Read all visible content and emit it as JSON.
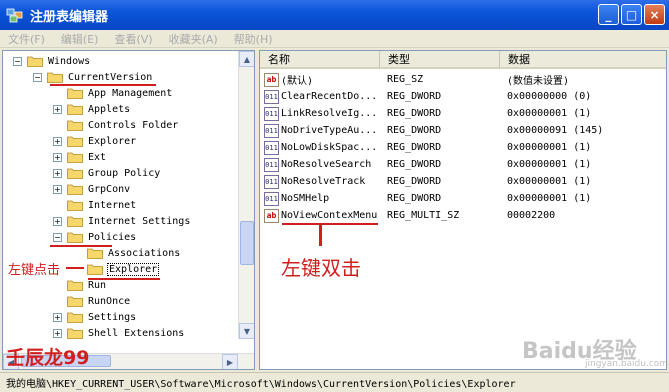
{
  "window": {
    "title": "注册表编辑器",
    "min": "_",
    "max": "□",
    "close": "×"
  },
  "menu": [
    "文件(F)",
    "编辑(E)",
    "查看(V)",
    "收藏夹(A)",
    "帮助(H)"
  ],
  "tree": [
    {
      "label": "Windows",
      "exp": "−",
      "level": 0
    },
    {
      "label": "CurrentVersion",
      "exp": "−",
      "level": 1,
      "underline": true
    },
    {
      "label": "App Management",
      "exp": "",
      "level": 2
    },
    {
      "label": "Applets",
      "exp": "+",
      "level": 2
    },
    {
      "label": "Controls Folder",
      "exp": "",
      "level": 2
    },
    {
      "label": "Explorer",
      "exp": "+",
      "level": 2
    },
    {
      "label": "Ext",
      "exp": "+",
      "level": 2
    },
    {
      "label": "Group Policy",
      "exp": "+",
      "level": 2
    },
    {
      "label": "GrpConv",
      "exp": "+",
      "level": 2
    },
    {
      "label": "Internet",
      "exp": "",
      "level": 2
    },
    {
      "label": "Internet Settings",
      "exp": "+",
      "level": 2
    },
    {
      "label": "Policies",
      "exp": "−",
      "level": 2,
      "underline": true
    },
    {
      "label": "Associations",
      "exp": "",
      "level": 3
    },
    {
      "label": "Explorer",
      "exp": "",
      "level": 3,
      "selected": true,
      "underline": true
    },
    {
      "label": "Run",
      "exp": "",
      "level": 2
    },
    {
      "label": "RunOnce",
      "exp": "",
      "level": 2
    },
    {
      "label": "Settings",
      "exp": "+",
      "level": 2
    },
    {
      "label": "Shell Extensions",
      "exp": "+",
      "level": 2
    }
  ],
  "columns": {
    "name": "名称",
    "type": "类型",
    "data": "数据"
  },
  "values": [
    {
      "icon": "ab",
      "name": "(默认)",
      "type": "REG_SZ",
      "data": "(数值未设置)"
    },
    {
      "icon": "011",
      "name": "ClearRecentDo...",
      "type": "REG_DWORD",
      "data": "0x00000000 (0)"
    },
    {
      "icon": "011",
      "name": "LinkResolveIg...",
      "type": "REG_DWORD",
      "data": "0x00000001 (1)"
    },
    {
      "icon": "011",
      "name": "NoDriveTypeAu...",
      "type": "REG_DWORD",
      "data": "0x00000091 (145)"
    },
    {
      "icon": "011",
      "name": "NoLowDiskSpac...",
      "type": "REG_DWORD",
      "data": "0x00000001 (1)"
    },
    {
      "icon": "011",
      "name": "NoResolveSearch",
      "type": "REG_DWORD",
      "data": "0x00000001 (1)"
    },
    {
      "icon": "011",
      "name": "NoResolveTrack",
      "type": "REG_DWORD",
      "data": "0x00000001 (1)"
    },
    {
      "icon": "011",
      "name": "NoSMHelp",
      "type": "REG_DWORD",
      "data": "0x00000001 (1)"
    },
    {
      "icon": "ab",
      "name": "NoViewContexMenu",
      "type": "REG_MULTI_SZ",
      "data": "00002200"
    }
  ],
  "status": "我的电脑\\HKEY_CURRENT_USER\\Software\\Microsoft\\Windows\\CurrentVersion\\Policies\\Explorer",
  "annotations": {
    "left_click": "左键点击",
    "double_click": "左键双击",
    "author": "壬辰龙99",
    "watermark": "Baidu经验",
    "watermark_url": "jingyan.baidu.com"
  }
}
